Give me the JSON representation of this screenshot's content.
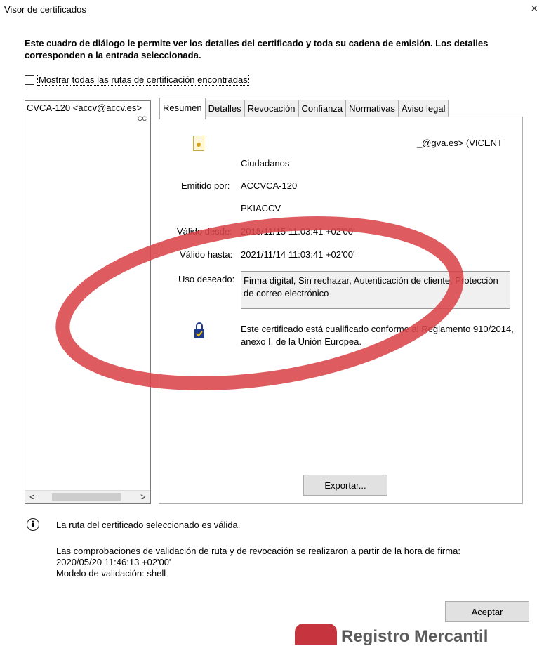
{
  "window": {
    "title": "Visor de certificados",
    "close_glyph": "×"
  },
  "description": "Este cuadro de diálogo le permite ver los detalles del certificado y toda su cadena de emisión. Los detalles corresponden a la entrada seleccionada.",
  "show_all_paths": {
    "label": "Mostrar todas las rutas de certificación encontradas",
    "checked": false
  },
  "tree": {
    "items": [
      "CVCA-120 <accv@accv.es>",
      "CC"
    ],
    "scroll_left_glyph": "<",
    "scroll_right_glyph": ">"
  },
  "tabs": [
    {
      "label": "Resumen",
      "active": true
    },
    {
      "label": "Detalles",
      "active": false
    },
    {
      "label": "Revocación",
      "active": false
    },
    {
      "label": "Confianza",
      "active": false
    },
    {
      "label": "Normativas",
      "active": false
    },
    {
      "label": "Aviso legal",
      "active": false
    }
  ],
  "summary": {
    "subject": "_@gva.es> (VICENT",
    "org_unit": "Ciudadanos",
    "issued_by_label": "Emitido por:",
    "issued_by": "ACCVCA-120",
    "issuer_org": "PKIACCV",
    "valid_from_label": "Válido desde:",
    "valid_from": "2018/11/15 11:03:41 +02'00'",
    "valid_to_label": "Válido hasta:",
    "valid_to": "2021/11/14 11:03:41 +02'00'",
    "usage_label": "Uso deseado:",
    "usage": "Firma digital, Sin rechazar, Autenticación de cliente, Protección de correo electrónico",
    "qualified_note": "Este certificado está cualificado conforme al Reglamento 910/2014, anexo I, de la Unión Europea.",
    "export_label": "Exportar..."
  },
  "status": {
    "message": "La ruta del certificado seleccionado es válida.",
    "validation_line1": "Las comprobaciones de validación de ruta y de revocación se realizaron a partir de la hora de firma:",
    "validation_time": "2020/05/20 11:46:13 +02'00'",
    "validation_model": "Modelo de validación: shell"
  },
  "ok_label": "Aceptar",
  "watermark": {
    "text": "Registro Mercantil"
  },
  "colors": {
    "highlight_ellipse": "#d9444a",
    "brand_red": "#c0202a"
  }
}
